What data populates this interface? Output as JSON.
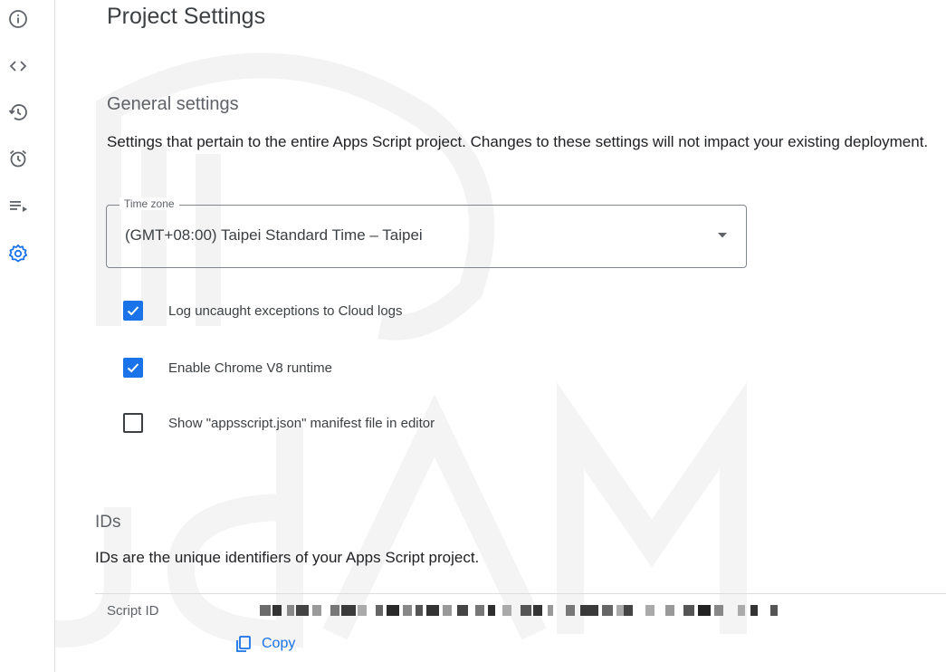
{
  "page": {
    "title": "Project Settings"
  },
  "rail": {
    "items": [
      {
        "name": "overview",
        "icon": "info-icon",
        "active": false
      },
      {
        "name": "editor",
        "icon": "code-icon",
        "active": false
      },
      {
        "name": "executions",
        "icon": "history-icon",
        "active": false
      },
      {
        "name": "triggers",
        "icon": "alarm-clock-icon",
        "active": false
      },
      {
        "name": "executions-list",
        "icon": "playlist-play-icon",
        "active": false
      },
      {
        "name": "project-settings",
        "icon": "gear-icon",
        "active": true
      }
    ],
    "active_color": "#1a73e8",
    "icon_color": "#5f6368"
  },
  "general": {
    "title": "General settings",
    "description": "Settings that pertain to the entire Apps Script project. Changes to these settings will not impact your existing deployment.",
    "timezone": {
      "label": "Time zone",
      "value": "(GMT+08:00) Taipei Standard Time – Taipei"
    },
    "options": [
      {
        "label": "Log uncaught exceptions to Cloud logs",
        "checked": true
      },
      {
        "label": "Enable Chrome V8 runtime",
        "checked": true
      },
      {
        "label": "Show \"appsscript.json\" manifest file in editor",
        "checked": false
      }
    ]
  },
  "ids": {
    "title": "IDs",
    "description": "IDs are the unique identifiers of your Apps Script project.",
    "script_id_label": "Script ID",
    "copy_label": "Copy"
  },
  "colors": {
    "accent": "#1a73e8",
    "text": "#202124",
    "muted": "#5f6368",
    "border": "#dadce0"
  }
}
